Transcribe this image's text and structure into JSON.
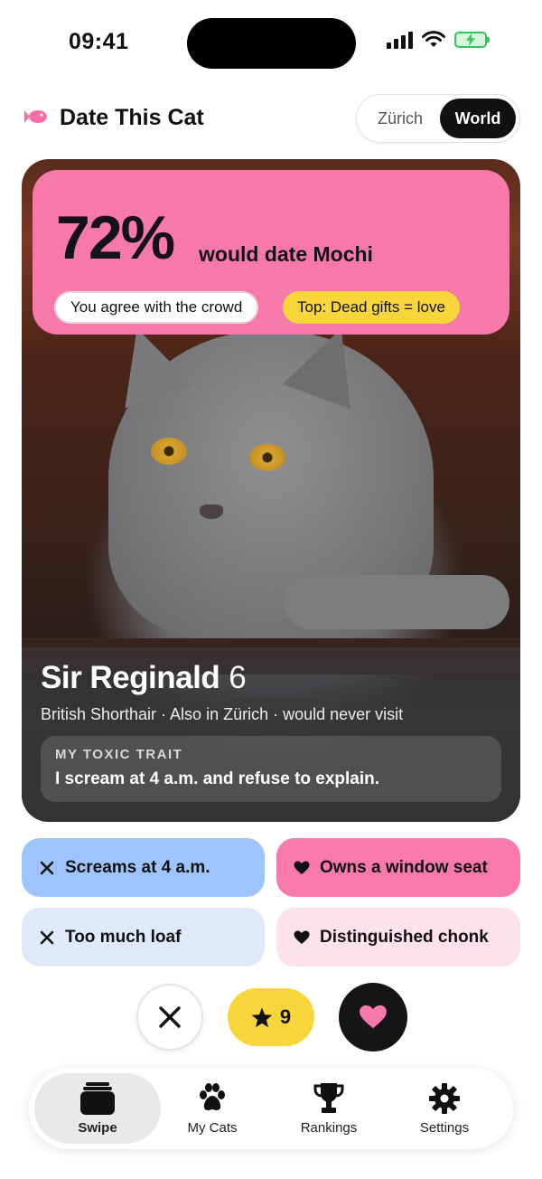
{
  "status_bar": {
    "time": "09:41"
  },
  "header": {
    "title": "Date This Cat",
    "location_toggle": {
      "options": [
        "Zürich",
        "World"
      ],
      "selected": "World"
    }
  },
  "result": {
    "percent": "72%",
    "label": "would date Mochi",
    "agree_pill": "You agree with the crowd",
    "top_pill": "Top: Dead gifts = love"
  },
  "profile": {
    "name": "Sir Reginald",
    "age": "6",
    "meta": "British Shorthair · Also in Zürich · would never visit",
    "trait_label": "MY TOXIC TRAIT",
    "trait_text": "I scream at 4 a.m. and refuse to explain."
  },
  "tags": [
    {
      "label": "Screams at 4 a.m.",
      "icon": "x-icon"
    },
    {
      "label": "Owns a window seat",
      "icon": "heart-icon"
    },
    {
      "label": "Too much loaf",
      "icon": "x-icon"
    },
    {
      "label": "Distinguished chonk",
      "icon": "heart-icon"
    }
  ],
  "actions": {
    "star_count": "9"
  },
  "tabbar": {
    "items": [
      {
        "label": "Swipe",
        "icon": "cards-icon",
        "active": true
      },
      {
        "label": "My Cats",
        "icon": "paw-icon"
      },
      {
        "label": "Rankings",
        "icon": "trophy-icon"
      },
      {
        "label": "Settings",
        "icon": "gear-icon"
      }
    ]
  },
  "colors": {
    "accent_pink": "#f779aa",
    "accent_yellow": "#f8d53a",
    "accent_blue": "#9ec5fb",
    "dark": "#141418"
  }
}
